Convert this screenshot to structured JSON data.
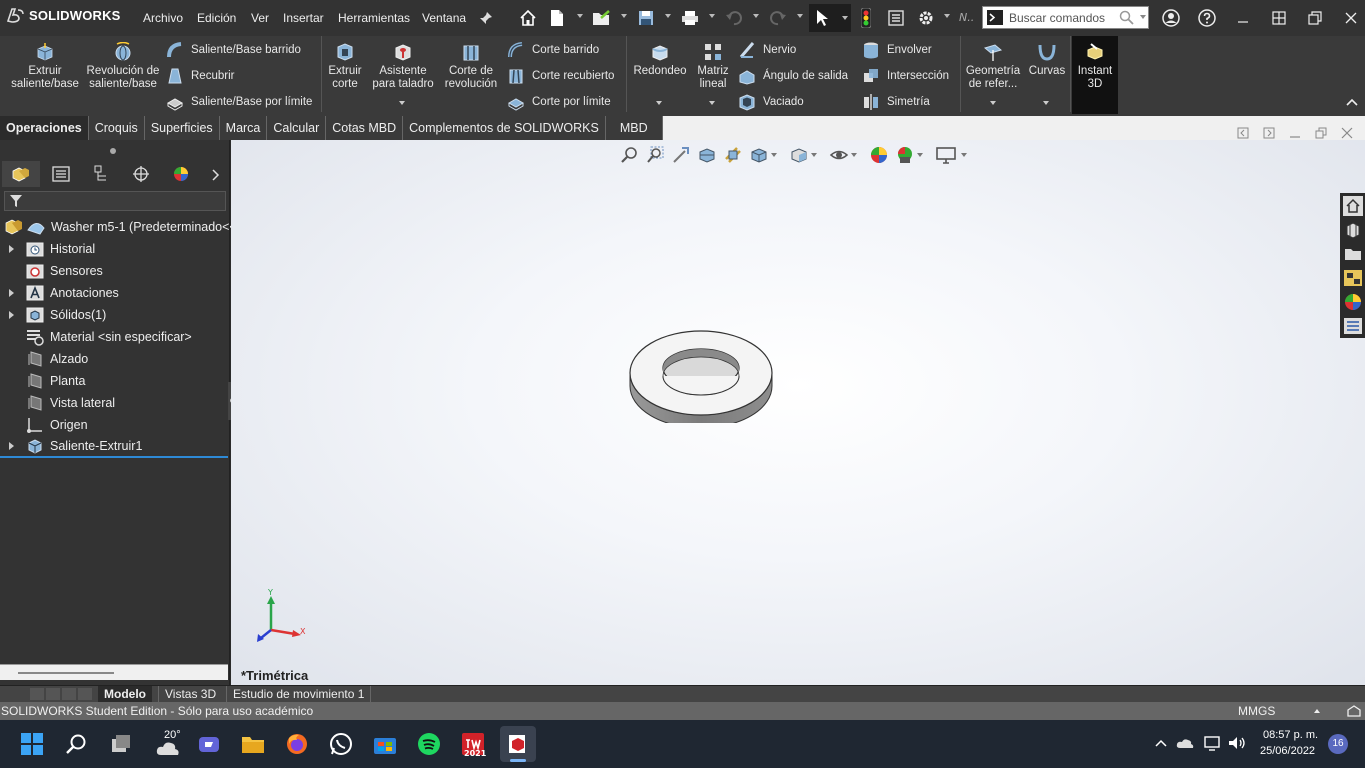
{
  "app": {
    "name": "SOLIDWORKS"
  },
  "menu": [
    "Archivo",
    "Edición",
    "Ver",
    "Insertar",
    "Herramientas",
    "Ventana"
  ],
  "toolbar": {
    "search_placeholder": "Buscar comandos",
    "extra": "N.."
  },
  "ribbon": {
    "extrude": "Extruir saliente/base",
    "revolve": "Revolución de saliente/base",
    "sweep": "Saliente/Base barrido",
    "loft": "Recubrir",
    "boundary": "Saliente/Base por límite",
    "extrude_cut": "Extruir corte",
    "hole_wizard": "Asistente para taladro",
    "revolve_cut": "Corte de revolución",
    "swept_cut": "Corte barrido",
    "lofted_cut": "Corte recubierto",
    "boundary_cut": "Corte por límite",
    "fillet": "Redondeo",
    "linear_pattern": "Matriz lineal",
    "rib": "Nervio",
    "draft": "Ángulo de salida",
    "shell": "Vaciado",
    "wrap": "Envolver",
    "intersect": "Intersección",
    "mirror": "Simetría",
    "ref_geometry": "Geometría de refer...",
    "curves": "Curvas",
    "instant3d": "Instant 3D"
  },
  "command_tabs": [
    "Operaciones",
    "Croquis",
    "Superficies",
    "Marca",
    "Calcular",
    "Cotas MBD",
    "Complementos de SOLIDWORKS",
    "MBD"
  ],
  "tree": {
    "root": "Washer m5-1  (Predeterminado<<",
    "items": [
      {
        "label": "Historial",
        "expandable": true,
        "icon": "history-folder-icon"
      },
      {
        "label": "Sensores",
        "expandable": false,
        "icon": "sensor-icon"
      },
      {
        "label": "Anotaciones",
        "expandable": true,
        "icon": "annotations-icon"
      },
      {
        "label": "Sólidos(1)",
        "expandable": true,
        "icon": "solid-bodies-icon"
      },
      {
        "label": "Material <sin especificar>",
        "expandable": false,
        "icon": "material-icon"
      },
      {
        "label": "Alzado",
        "expandable": false,
        "icon": "plane-icon"
      },
      {
        "label": "Planta",
        "expandable": false,
        "icon": "plane-icon"
      },
      {
        "label": "Vista lateral",
        "expandable": false,
        "icon": "plane-icon"
      },
      {
        "label": "Origen",
        "expandable": false,
        "icon": "origin-icon"
      },
      {
        "label": "Saliente-Extruir1",
        "expandable": true,
        "icon": "extrude-feature-icon"
      }
    ]
  },
  "viewport": {
    "view_label": "*Trimétrica",
    "triad": {
      "x": "X",
      "y": "Y"
    }
  },
  "bottom_tabs": [
    "Modelo",
    "Vistas 3D",
    "Estudio de movimiento 1"
  ],
  "status": {
    "left": "SOLIDWORKS Student Edition - Sólo para uso académico",
    "units": "MMGS"
  },
  "taskbar": {
    "weather": "20°",
    "time": "08:57 p. m.",
    "date": "25/06/2022",
    "notifications": "16",
    "sw_badge": "2021"
  }
}
